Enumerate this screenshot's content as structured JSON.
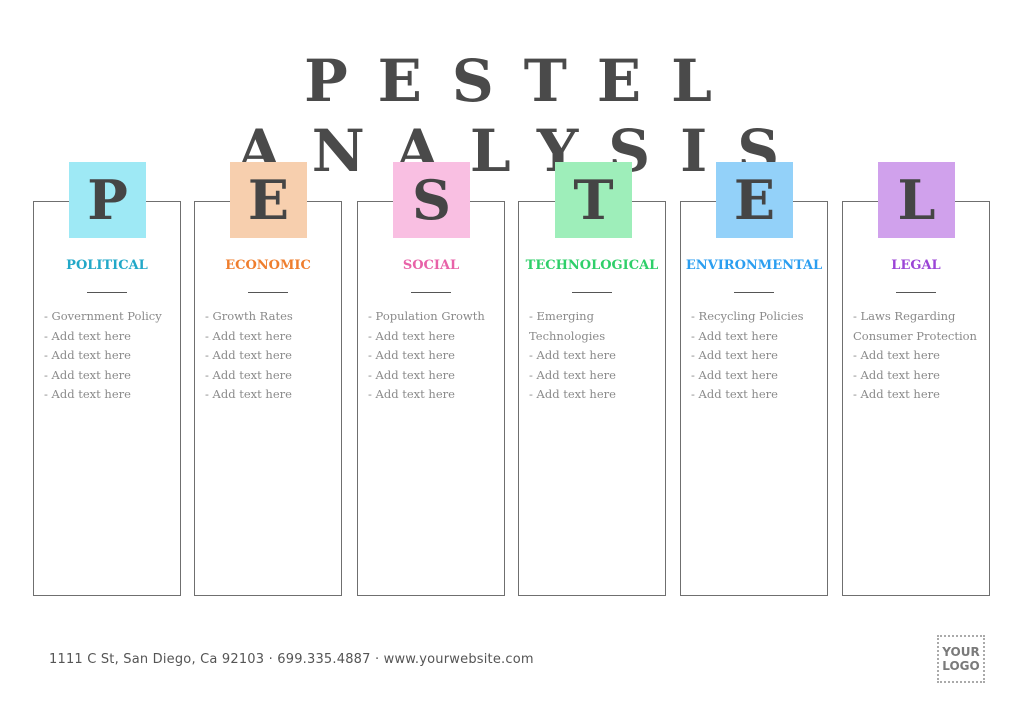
{
  "title": "PESTEL ANALYSIS",
  "factors": [
    {
      "letter": "P",
      "label": "POLITICAL",
      "badge_color": "#9ee9f5",
      "label_color": "#22a8c8",
      "items": [
        "- Government Policy",
        "- Add text here",
        "- Add text here",
        "- Add text here",
        "- Add text here"
      ]
    },
    {
      "letter": "E",
      "label": "ECONOMIC",
      "badge_color": "#f7cfae",
      "label_color": "#ef7e2e",
      "items": [
        "- Growth Rates",
        "- Add text here",
        "- Add text here",
        "- Add text here",
        "- Add text here"
      ]
    },
    {
      "letter": "S",
      "label": "SOCIAL",
      "badge_color": "#f9bfe2",
      "label_color": "#e862a8",
      "items": [
        "- Population Growth",
        "- Add text here",
        "- Add text here",
        "- Add text here",
        "- Add text here"
      ]
    },
    {
      "letter": "T",
      "label": "TECHNOLOGICAL",
      "badge_color": "#9eeeba",
      "label_color": "#2fcf6a",
      "items": [
        "- Emerging",
        "Technologies",
        "- Add text here",
        "- Add text here",
        "- Add text here"
      ]
    },
    {
      "letter": "E",
      "label": "ENVIRONMENTAL",
      "badge_color": "#93d1f9",
      "label_color": "#2b9ef0",
      "items": [
        "- Recycling Policies",
        "- Add text here",
        "- Add text here",
        "- Add text here",
        "- Add text here"
      ]
    },
    {
      "letter": "L",
      "label": "LEGAL",
      "badge_color": "#d0a1ec",
      "label_color": "#9b45d6",
      "items": [
        "- Laws Regarding",
        "Consumer Protection",
        "- Add text here",
        "- Add text here",
        "- Add text here"
      ]
    }
  ],
  "footer": {
    "contact": "1111 C St, San Diego, Ca 92103 · 699.335.4887 · www.yourwebsite.com"
  },
  "logo": {
    "line1": "YOUR",
    "line2": "LOGO"
  }
}
